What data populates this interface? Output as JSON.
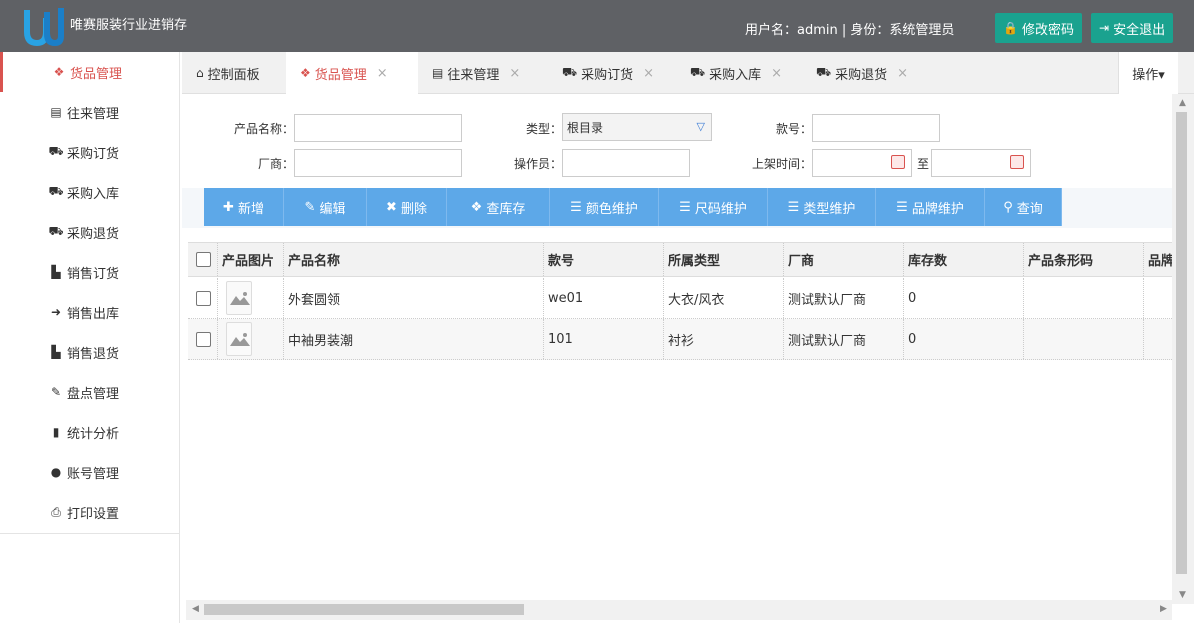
{
  "header": {
    "app_title": "唯赛服装行业进销存",
    "user_info": "用户名：admin  |  身份：系统管理员",
    "change_password": "修改密码",
    "logout": "安全退出",
    "accent": "#1aa28f"
  },
  "sidebar": {
    "items": [
      {
        "label": "货品管理",
        "icon": "cubes-icon",
        "active": true
      },
      {
        "label": "往来管理",
        "icon": "id-card-icon"
      },
      {
        "label": "采购订货",
        "icon": "cart-icon"
      },
      {
        "label": "采购入库",
        "icon": "cart-icon"
      },
      {
        "label": "采购退货",
        "icon": "cart-icon"
      },
      {
        "label": "销售订货",
        "icon": "bag-icon"
      },
      {
        "label": "销售出库",
        "icon": "sign-in-icon"
      },
      {
        "label": "销售退货",
        "icon": "bag-icon"
      },
      {
        "label": "盘点管理",
        "icon": "edit-icon"
      },
      {
        "label": "统计分析",
        "icon": "bar-chart-icon"
      },
      {
        "label": "账号管理",
        "icon": "user-icon"
      },
      {
        "label": "打印设置",
        "icon": "print-icon"
      }
    ]
  },
  "tabs": [
    {
      "label": "控制面板",
      "icon": "home-icon",
      "closable": false
    },
    {
      "label": "货品管理",
      "icon": "cubes-icon",
      "closable": true,
      "active": true
    },
    {
      "label": "往来管理",
      "icon": "id-card-icon",
      "closable": true
    },
    {
      "label": "采购订货",
      "icon": "cart-icon",
      "closable": true
    },
    {
      "label": "采购入库",
      "icon": "cart-icon",
      "closable": true
    },
    {
      "label": "采购退货",
      "icon": "cart-icon",
      "closable": true
    }
  ],
  "tab_ops": "操作▾",
  "filters": {
    "product_name_label": "产品名称：",
    "type_label": "类型：",
    "type_value": "根目录",
    "style_no_label": "款号：",
    "vendor_label": "厂商：",
    "operator_label": "操作员：",
    "listing_time_label": "上架时间：",
    "to_label": "至"
  },
  "toolbar": [
    {
      "label": "新增",
      "icon": "plus-icon",
      "glyph": "✚"
    },
    {
      "label": "编辑",
      "icon": "edit-icon",
      "glyph": "✎"
    },
    {
      "label": "删除",
      "icon": "times-icon",
      "glyph": "✖"
    },
    {
      "label": "查库存",
      "icon": "cubes-icon",
      "glyph": "❖"
    },
    {
      "label": "颜色维护",
      "icon": "list-icon",
      "glyph": "☰"
    },
    {
      "label": "尺码维护",
      "icon": "list-icon",
      "glyph": "☰"
    },
    {
      "label": "类型维护",
      "icon": "list-icon",
      "glyph": "☰"
    },
    {
      "label": "品牌维护",
      "icon": "list-icon",
      "glyph": "☰"
    },
    {
      "label": "查询",
      "icon": "search-icon",
      "glyph": "⚲"
    }
  ],
  "table": {
    "columns": [
      "产品图片",
      "产品名称",
      "款号",
      "所属类型",
      "厂商",
      "库存数",
      "产品条形码",
      "品牌"
    ],
    "rows": [
      {
        "name": "外套圆领",
        "style_no": "we01",
        "type": "大衣/风衣",
        "vendor": "测试默认厂商",
        "stock": "0",
        "barcode": "",
        "brand": ""
      },
      {
        "name": "中袖男装潮",
        "style_no": "101",
        "type": "衬衫",
        "vendor": "测试默认厂商",
        "stock": "0",
        "barcode": "",
        "brand": ""
      }
    ]
  }
}
